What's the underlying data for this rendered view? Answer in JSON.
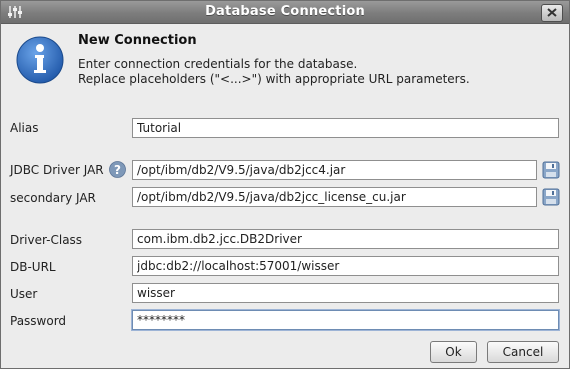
{
  "window": {
    "title": "Database Connection"
  },
  "header": {
    "title": "New Connection",
    "desc_line1": "Enter connection credentials for the database.",
    "desc_line2": "Replace placeholders (\"<...>\") with appropriate URL parameters."
  },
  "form": {
    "alias": {
      "label": "Alias",
      "value": "Tutorial"
    },
    "jdbc_jar": {
      "label": "JDBC Driver JAR",
      "value": "/opt/ibm/db2/V9.5/java/db2jcc4.jar"
    },
    "secondary_jar": {
      "label": "secondary JAR",
      "value": "/opt/ibm/db2/V9.5/java/db2jcc_license_cu.jar"
    },
    "driver_class": {
      "label": "Driver-Class",
      "value": "com.ibm.db2.jcc.DB2Driver"
    },
    "db_url": {
      "label": "DB-URL",
      "value": "jdbc:db2://localhost:57001/wisser"
    },
    "user": {
      "label": "User",
      "value": "wisser"
    },
    "password": {
      "label": "Password",
      "value": "********"
    }
  },
  "buttons": {
    "ok": "Ok",
    "cancel": "Cancel"
  },
  "icons": {
    "info": "info-icon",
    "help": "help-icon",
    "save": "save-icon",
    "close": "close-icon",
    "menu": "window-menu-icon"
  },
  "colors": {
    "info_blue": "#2f6fc4",
    "titlebar": "#7d7d7d",
    "focus": "#6e8cb3"
  }
}
